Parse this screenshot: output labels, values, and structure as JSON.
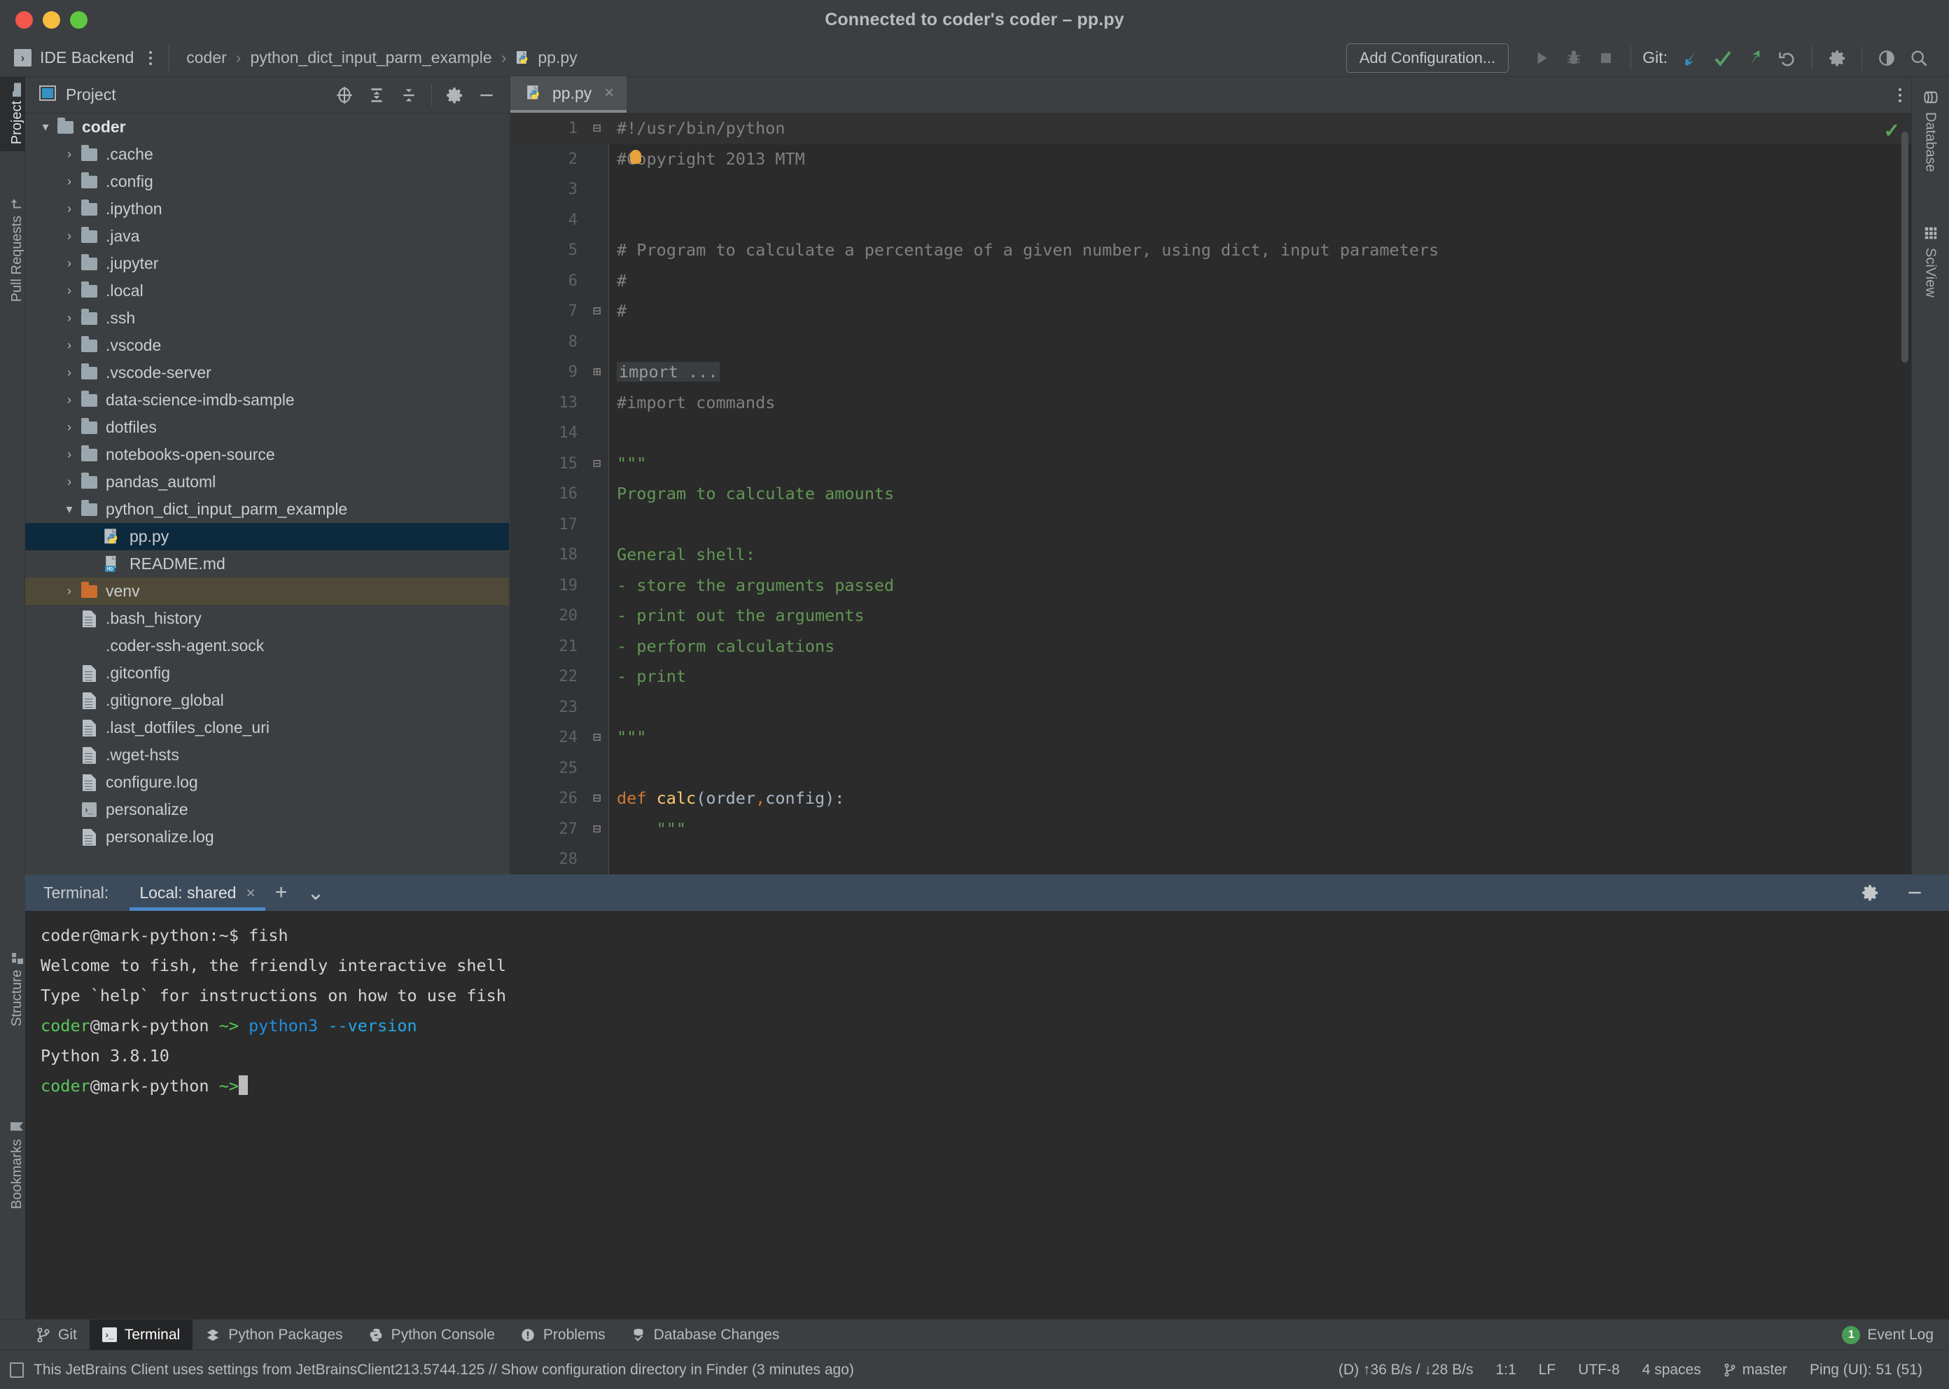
{
  "window": {
    "title": "Connected to coder's coder – pp.py",
    "traffic_lights": [
      "close",
      "minimize",
      "zoom"
    ]
  },
  "navbar": {
    "ide_backend_label": "IDE Backend",
    "ide_badge": "›",
    "breadcrumb": [
      "coder",
      "python_dict_input_parm_example",
      "pp.py"
    ],
    "add_configuration": "Add Configuration...",
    "git_label": "Git:",
    "icons": [
      "run-icon",
      "debug-icon",
      "stop-icon",
      "git-update-icon",
      "git-commit-icon",
      "git-push-icon",
      "undo-icon",
      "settings-icon",
      "search-everywhere-icon",
      "magnifier-icon"
    ]
  },
  "left_tool_strip": [
    {
      "label": "Project",
      "icon": "folder-icon",
      "active": true
    },
    {
      "label": "Pull Requests",
      "icon": "pull-request-icon",
      "active": false
    }
  ],
  "left_tool_strip_bottom": [
    {
      "label": "Structure",
      "icon": "structure-icon"
    },
    {
      "label": "Bookmarks",
      "icon": "bookmark-icon"
    }
  ],
  "right_tool_strip": [
    {
      "label": "Database",
      "icon": "database-icon"
    },
    {
      "label": "SciView",
      "icon": "grid-icon"
    }
  ],
  "project_panel": {
    "title": "Project",
    "header_icons": [
      "select-opened-file-icon",
      "expand-all-icon",
      "collapse-all-icon",
      "gear-icon",
      "hide-icon"
    ],
    "tree": [
      {
        "label": "coder",
        "type": "folder",
        "depth": 0,
        "arrow": "down",
        "bold": true
      },
      {
        "label": ".cache",
        "type": "folder",
        "depth": 1,
        "arrow": "right"
      },
      {
        "label": ".config",
        "type": "folder",
        "depth": 1,
        "arrow": "right"
      },
      {
        "label": ".ipython",
        "type": "folder",
        "depth": 1,
        "arrow": "right"
      },
      {
        "label": ".java",
        "type": "folder",
        "depth": 1,
        "arrow": "right"
      },
      {
        "label": ".jupyter",
        "type": "folder",
        "depth": 1,
        "arrow": "right"
      },
      {
        "label": ".local",
        "type": "folder",
        "depth": 1,
        "arrow": "right"
      },
      {
        "label": ".ssh",
        "type": "folder",
        "depth": 1,
        "arrow": "right"
      },
      {
        "label": ".vscode",
        "type": "folder",
        "depth": 1,
        "arrow": "right"
      },
      {
        "label": ".vscode-server",
        "type": "folder",
        "depth": 1,
        "arrow": "right"
      },
      {
        "label": "data-science-imdb-sample",
        "type": "folder",
        "depth": 1,
        "arrow": "right"
      },
      {
        "label": "dotfiles",
        "type": "folder",
        "depth": 1,
        "arrow": "right"
      },
      {
        "label": "notebooks-open-source",
        "type": "folder",
        "depth": 1,
        "arrow": "right"
      },
      {
        "label": "pandas_automl",
        "type": "folder",
        "depth": 1,
        "arrow": "right"
      },
      {
        "label": "python_dict_input_parm_example",
        "type": "folder",
        "depth": 1,
        "arrow": "down"
      },
      {
        "label": "pp.py",
        "type": "python",
        "depth": 2,
        "arrow": "none",
        "selected": true
      },
      {
        "label": "README.md",
        "type": "markdown",
        "depth": 2,
        "arrow": "none"
      },
      {
        "label": "venv",
        "type": "folder-orange",
        "depth": 1,
        "arrow": "right",
        "highlight": "venv"
      },
      {
        "label": ".bash_history",
        "type": "file",
        "depth": 1,
        "arrow": "none"
      },
      {
        "label": ".coder-ssh-agent.sock",
        "type": "none",
        "depth": 1,
        "arrow": "none"
      },
      {
        "label": ".gitconfig",
        "type": "file",
        "depth": 1,
        "arrow": "none"
      },
      {
        "label": ".gitignore_global",
        "type": "file",
        "depth": 1,
        "arrow": "none"
      },
      {
        "label": ".last_dotfiles_clone_uri",
        "type": "file",
        "depth": 1,
        "arrow": "none"
      },
      {
        "label": ".wget-hsts",
        "type": "file",
        "depth": 1,
        "arrow": "none"
      },
      {
        "label": "configure.log",
        "type": "file",
        "depth": 1,
        "arrow": "none"
      },
      {
        "label": "personalize",
        "type": "shell",
        "depth": 1,
        "arrow": "none"
      },
      {
        "label": "personalize.log",
        "type": "file",
        "depth": 1,
        "arrow": "none"
      }
    ]
  },
  "editor": {
    "tab": {
      "label": "pp.py",
      "icon": "python-file-icon",
      "close": "×"
    },
    "inspection_status": "check-icon",
    "lines": [
      {
        "num": "1",
        "text": "#!/usr/bin/python",
        "cls": "c-comment",
        "fold": "minus",
        "hl": true
      },
      {
        "num": "2",
        "text": "#Copyright 2013 MTM",
        "cls": "c-comment",
        "bulb": true
      },
      {
        "num": "3",
        "text": "",
        "cls": "c-comment"
      },
      {
        "num": "4",
        "text": "",
        "cls": "c-comment"
      },
      {
        "num": "5",
        "text": "# Program to calculate a percentage of a given number, using dict, input parameters",
        "cls": "c-comment"
      },
      {
        "num": "6",
        "text": "#",
        "cls": "c-comment"
      },
      {
        "num": "7",
        "text": "#",
        "cls": "c-comment",
        "fold": "minus-end"
      },
      {
        "num": "8",
        "text": "",
        "cls": "c-plain"
      },
      {
        "num": "9",
        "text": "import ...",
        "cls": "c-plain",
        "fold": "plus",
        "folded": true
      },
      {
        "num": "13",
        "text": "#import commands",
        "cls": "c-comment"
      },
      {
        "num": "14",
        "text": "",
        "cls": "c-plain"
      },
      {
        "num": "15",
        "text": "\"\"\"",
        "cls": "c-string",
        "fold": "minus"
      },
      {
        "num": "16",
        "text": "Program to calculate amounts",
        "cls": "c-string"
      },
      {
        "num": "17",
        "text": "",
        "cls": "c-string"
      },
      {
        "num": "18",
        "text": "General shell:",
        "cls": "c-string"
      },
      {
        "num": "19",
        "text": "- store the arguments passed",
        "cls": "c-string"
      },
      {
        "num": "20",
        "text": "- print out the arguments",
        "cls": "c-string"
      },
      {
        "num": "21",
        "text": "- perform calculations",
        "cls": "c-string"
      },
      {
        "num": "22",
        "text": "- print",
        "cls": "c-string"
      },
      {
        "num": "23",
        "text": "",
        "cls": "c-string"
      },
      {
        "num": "24",
        "text": "\"\"\"",
        "cls": "c-string",
        "fold": "minus-end"
      },
      {
        "num": "25",
        "text": "",
        "cls": "c-plain"
      },
      {
        "num": "26",
        "text": "def calc(order,config):",
        "cls": "c-keyword-def",
        "fold": "minus"
      },
      {
        "num": "27",
        "text": "    \"\"\"",
        "cls": "c-string",
        "fold": "minus"
      },
      {
        "num": "28",
        "text": "",
        "cls": "c-plain"
      }
    ]
  },
  "terminal": {
    "label": "Terminal:",
    "tab": "Local: shared",
    "tab_close": "×",
    "add_icon": "+",
    "dropdown_icon": "⌄",
    "settings_icon": "gear-icon",
    "hide_icon": "minimize-icon",
    "lines": [
      {
        "segments": [
          {
            "t": "coder@mark-python:~$ fish",
            "c": "plain"
          }
        ]
      },
      {
        "segments": [
          {
            "t": "Welcome to fish, the friendly interactive shell",
            "c": "plain"
          }
        ]
      },
      {
        "segments": [
          {
            "t": "Type `help` for instructions on how to use fish",
            "c": "plain"
          }
        ]
      },
      {
        "segments": [
          {
            "t": "coder",
            "c": "green"
          },
          {
            "t": "@mark-python ",
            "c": "plain"
          },
          {
            "t": "~>",
            "c": "green"
          },
          {
            "t": " ",
            "c": "plain"
          },
          {
            "t": "python3 ",
            "c": "blue"
          },
          {
            "t": "--version",
            "c": "cyan"
          }
        ]
      },
      {
        "segments": [
          {
            "t": "Python 3.8.10",
            "c": "plain"
          }
        ]
      },
      {
        "segments": [
          {
            "t": "coder",
            "c": "green"
          },
          {
            "t": "@mark-python ",
            "c": "plain"
          },
          {
            "t": "~>",
            "c": "green"
          }
        ],
        "cursor": true
      }
    ]
  },
  "toolwindow_bar": {
    "items": [
      {
        "label": "Git",
        "icon": "git-branch-icon",
        "active": false
      },
      {
        "label": "Terminal",
        "icon": "terminal-icon",
        "active": true
      },
      {
        "label": "Python Packages",
        "icon": "packages-icon",
        "active": false
      },
      {
        "label": "Python Console",
        "icon": "python-icon",
        "active": false
      },
      {
        "label": "Problems",
        "icon": "problems-icon",
        "active": false
      },
      {
        "label": "Database Changes",
        "icon": "database-changes-icon",
        "active": false
      }
    ],
    "event_log": {
      "label": "Event Log",
      "count": "1"
    }
  },
  "statusbar": {
    "message": "This JetBrains Client uses settings from JetBrainsClient213.5744.125 // Show configuration directory in Finder (3 minutes ago)",
    "items": [
      {
        "label": "(D) ↑36 B/s / ↓28 B/s"
      },
      {
        "label": "1:1"
      },
      {
        "label": "LF"
      },
      {
        "label": "UTF-8"
      },
      {
        "label": "4 spaces"
      },
      {
        "label": "master",
        "icon": "git-branch-icon"
      },
      {
        "label": "Ping (UI): 51 (51)"
      }
    ]
  },
  "colors": {
    "accent_blue": "#4a88c7",
    "selection_blue": "#0d293e",
    "venv_highlight": "#4f4a37",
    "string_green": "#629755",
    "comment_gray": "#808080",
    "keyword_orange": "#cc7832",
    "terminal_bg": "#2b2b2b",
    "panel_bg": "#3c3f41"
  }
}
